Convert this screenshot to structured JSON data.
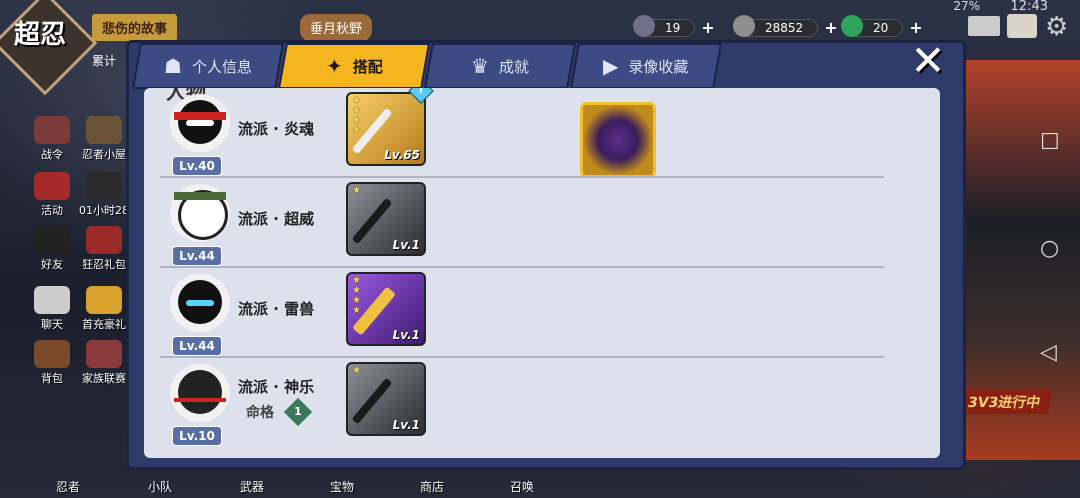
{
  "status_bar": {
    "battery": "27%",
    "time": "12:43"
  },
  "game": {
    "logo_text": "超忍",
    "story_label": "悲伤的故事",
    "accum_label": "累计",
    "event_label": "垂月秋野"
  },
  "currency": [
    {
      "icon": "shuriken-token-icon",
      "value": "19",
      "color": "#6f6f8a"
    },
    {
      "icon": "coin-icon",
      "value": "28852",
      "color": "#8f8f8f"
    },
    {
      "icon": "jade-icon",
      "value": "20",
      "color": "#2fa55c"
    }
  ],
  "sidebar": [
    {
      "label": "战令"
    },
    {
      "label": "忍者小屋"
    },
    {
      "label": "活动"
    },
    {
      "label": "01小时28"
    },
    {
      "label": "好友"
    },
    {
      "label": "狂忍礼包"
    },
    {
      "label": "聊天"
    },
    {
      "label": "首充豪礼"
    },
    {
      "label": "背包"
    },
    {
      "label": "家族联赛"
    }
  ],
  "bottom_nav": [
    {
      "label": "忍者"
    },
    {
      "label": "小队"
    },
    {
      "label": "武器"
    },
    {
      "label": "宝物"
    },
    {
      "label": "商店"
    },
    {
      "label": "召唤"
    }
  ],
  "right_banner": "3V3进行中",
  "modal": {
    "tabs": [
      {
        "label": "个人信息",
        "icon": "profile-icon",
        "active": false
      },
      {
        "label": "搭配",
        "icon": "shuriken-icon",
        "active": true
      },
      {
        "label": "成就",
        "icon": "trophy-icon",
        "active": false
      },
      {
        "label": "录像收藏",
        "icon": "play-icon",
        "active": false
      }
    ],
    "section_title": "人物",
    "rows": [
      {
        "level": "Lv.40",
        "style": "流派 · 炎魂",
        "weapon_level": "Lv.65",
        "weapon_stars": 4,
        "weapon_rarity": "gold",
        "fate_label": "",
        "has_accessory": true
      },
      {
        "level": "Lv.44",
        "style": "流派 · 超威",
        "weapon_level": "Lv.1",
        "weapon_stars": 1,
        "weapon_rarity": "dark",
        "fate_label": "",
        "has_accessory": false
      },
      {
        "level": "Lv.44",
        "style": "流派 · 雷兽",
        "weapon_level": "Lv.1",
        "weapon_stars": 4,
        "weapon_rarity": "purple",
        "fate_label": "",
        "has_accessory": false
      },
      {
        "level": "Lv.10",
        "style": "流派 · 神乐",
        "weapon_level": "Lv.1",
        "weapon_stars": 1,
        "weapon_rarity": "dark",
        "fate_label": "命格",
        "fate_value": "1",
        "has_accessory": false
      }
    ]
  }
}
